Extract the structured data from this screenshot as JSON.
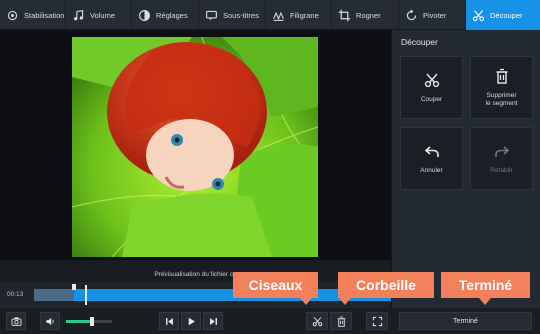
{
  "toolbar": {
    "items": [
      {
        "label": "Stabilisation",
        "icon": "stabilization-icon"
      },
      {
        "label": "Volume",
        "icon": "music-note-icon"
      },
      {
        "label": "Réglages",
        "icon": "adjustments-icon"
      },
      {
        "label": "Sous-titres",
        "icon": "subtitles-icon"
      },
      {
        "label": "Filigrane",
        "icon": "watermark-icon"
      },
      {
        "label": "Rogner",
        "icon": "crop-icon"
      },
      {
        "label": "Pivoter",
        "icon": "rotate-icon"
      },
      {
        "label": "Découper",
        "icon": "scissors-icon",
        "active": true
      }
    ]
  },
  "panel": {
    "title": "Découper",
    "buttons": {
      "cut": "Couper",
      "delete_line1": "Supprimer",
      "delete_line2": "le segment",
      "undo": "Annuler",
      "redo": "Rétablir"
    }
  },
  "preview": {
    "caption": "Prévisualisation du fichier co"
  },
  "timeline": {
    "timecode": "00:13"
  },
  "controls": {
    "done_label": "Terminé",
    "volume_level": 0.57
  },
  "callouts": {
    "scissors": "Ciseaux",
    "trash": "Corbeille",
    "done": "Terminé"
  },
  "colors": {
    "accent": "#1592e6",
    "callout": "#f2805a",
    "volume": "#2ec68a"
  }
}
